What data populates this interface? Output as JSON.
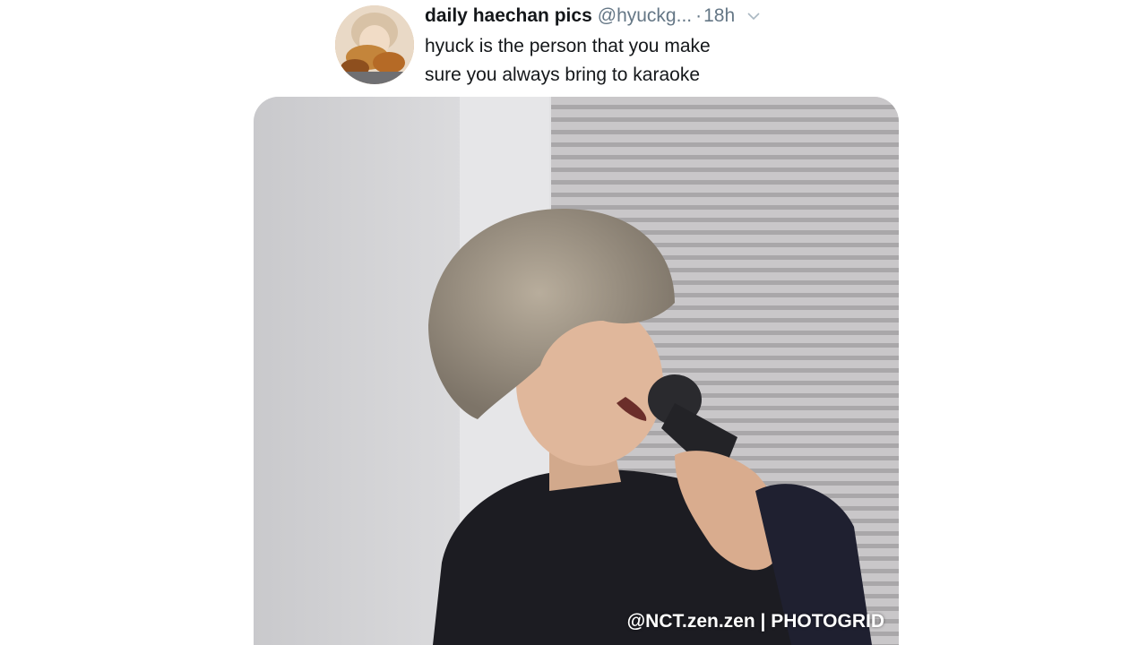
{
  "tweet": {
    "display_name": "daily haechan pics",
    "handle": "@hyuckg...",
    "separator": "·",
    "time": "18h",
    "text_lines": [
      "hyuck is the person that you make",
      "sure you always bring to karaoke"
    ],
    "media": {
      "watermark": "@NCT.zen.zen | PHOTOGRID"
    }
  },
  "icons": {
    "avatar": "profile-avatar",
    "caret": "chevron-down-icon"
  },
  "colors": {
    "name": "#14171a",
    "secondary": "#657786",
    "background": "#ffffff"
  }
}
